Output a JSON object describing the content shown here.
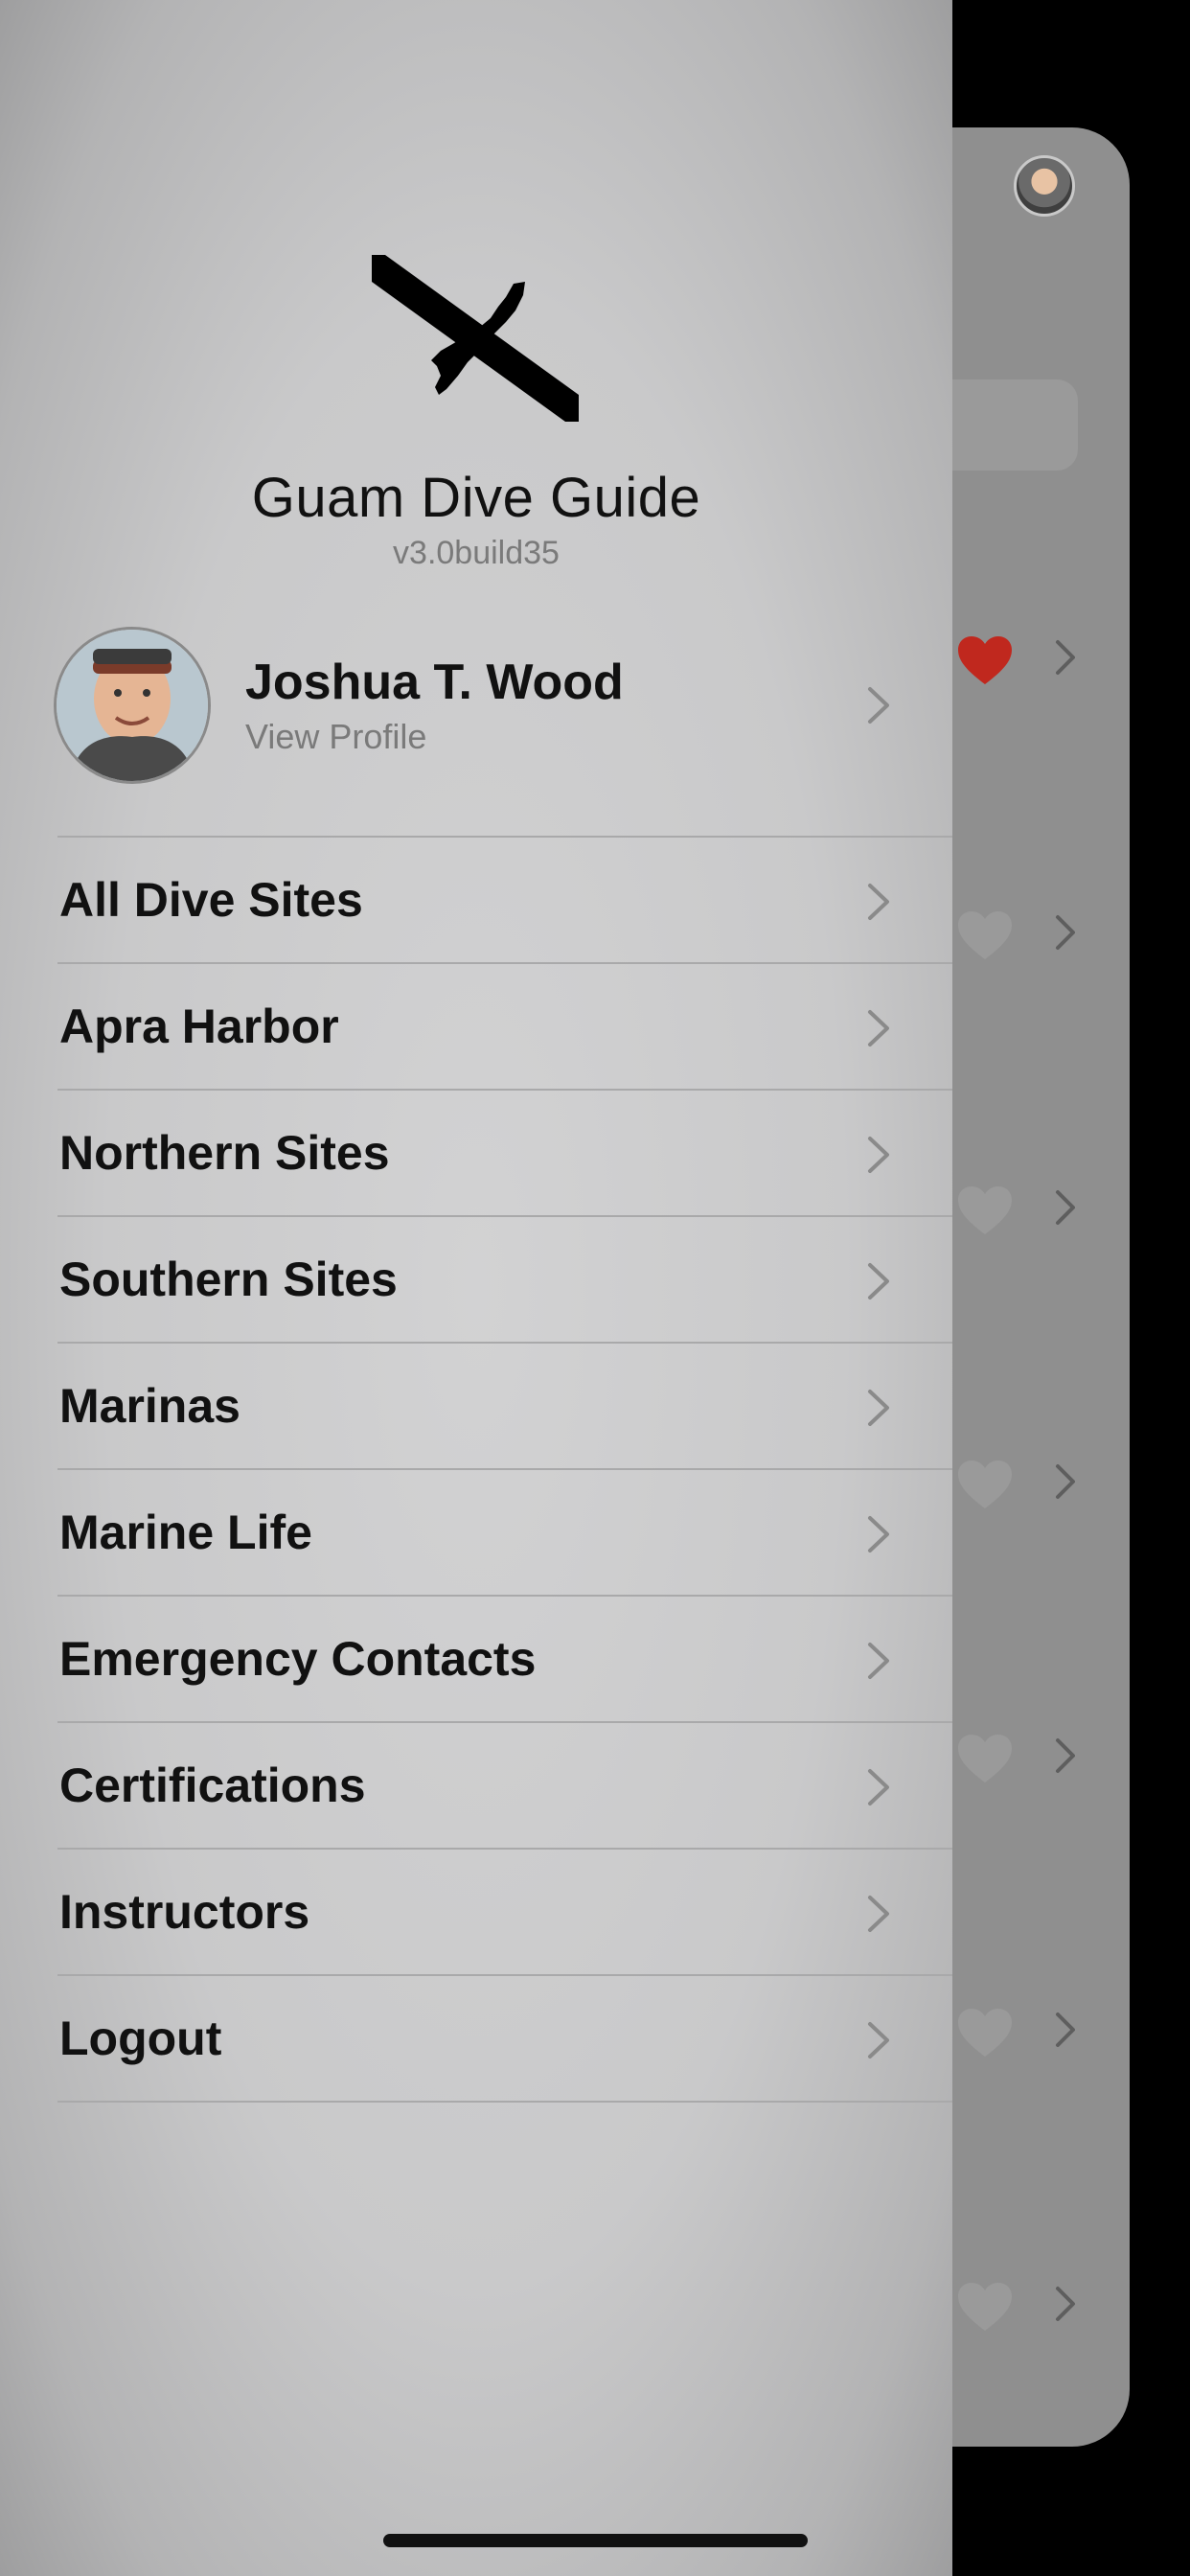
{
  "app": {
    "title": "Guam Dive Guide",
    "version": "v3.0build35"
  },
  "profile": {
    "name": "Joshua T. Wood",
    "subtitle": "View Profile"
  },
  "menu": {
    "items": [
      {
        "label": "All Dive Sites"
      },
      {
        "label": "Apra Harbor"
      },
      {
        "label": "Northern Sites"
      },
      {
        "label": "Southern Sites"
      },
      {
        "label": "Marinas"
      },
      {
        "label": "Marine Life"
      },
      {
        "label": "Emergency Contacts"
      },
      {
        "label": "Certifications"
      },
      {
        "label": "Instructors"
      },
      {
        "label": "Logout"
      }
    ]
  },
  "colors": {
    "favorite_active": "#c0281e",
    "favorite_inactive": "#9a9a9a"
  }
}
